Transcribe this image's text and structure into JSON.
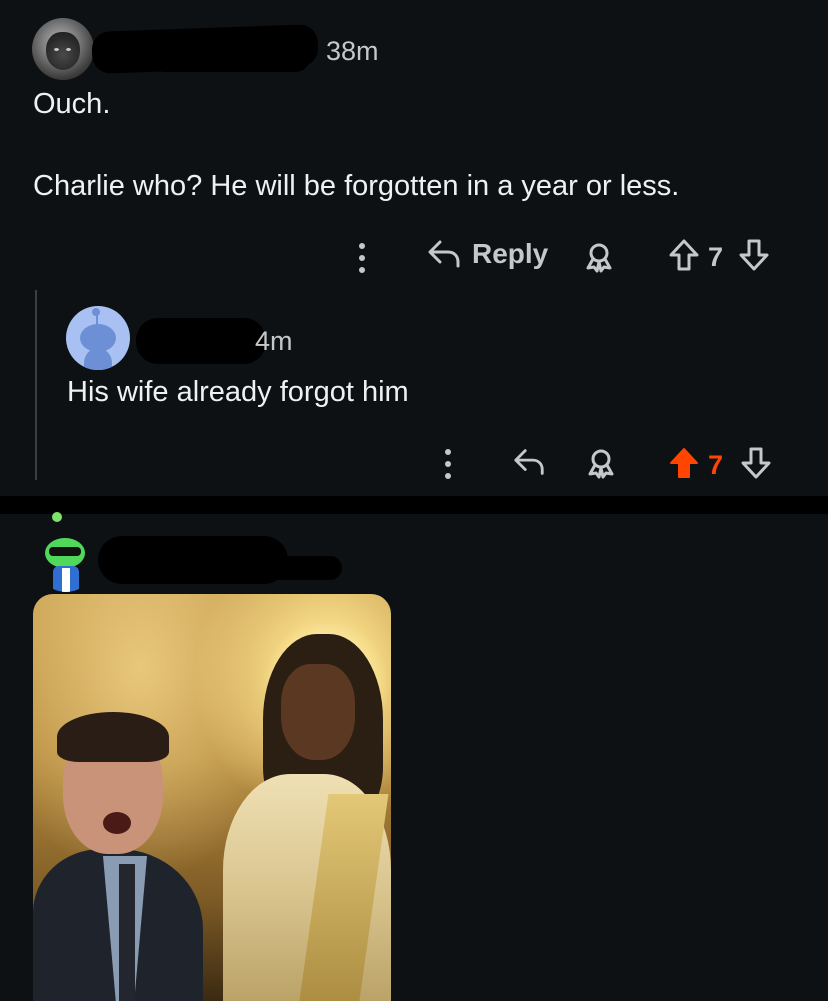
{
  "comment1": {
    "time": "38m",
    "lines": [
      "Ouch.",
      "Charlie who? He will be forgotten in a year or less."
    ],
    "actions": {
      "reply_label": "Reply",
      "vote_count": "7"
    }
  },
  "reply1": {
    "time": "4m",
    "text": "His wife already forgot him",
    "actions": {
      "vote_count": "7",
      "upvoted": true
    }
  },
  "comment2": {
    "image_alt_note": ""
  },
  "colors": {
    "background": "#0e1113",
    "upvote_active": "#ff4500",
    "text": "#eef1f3",
    "muted": "#c4c8cb"
  },
  "icons": [
    "more-options-icon",
    "reply-arrow-icon",
    "award-icon",
    "upvote-arrow-icon",
    "downvote-arrow-icon"
  ]
}
